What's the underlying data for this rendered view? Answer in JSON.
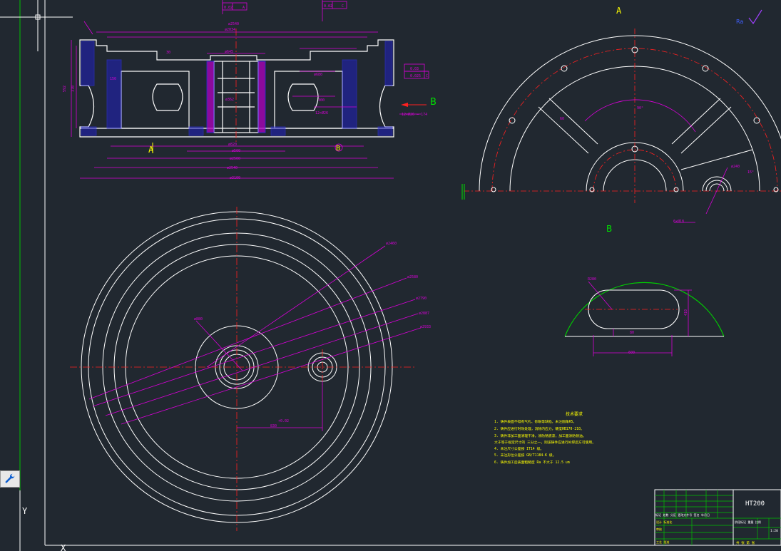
{
  "view_labels": {
    "section_a_marker": "A",
    "section_b_marker": "B",
    "view_a_title": "A",
    "view_b_title": "B",
    "bottom_b_marker": "B"
  },
  "tolerance_frames": {
    "top_left": [
      "0.02",
      "A"
    ],
    "top_right": [
      "0.02",
      "C"
    ],
    "right_1": [
      "0.03"
    ],
    "right_2": [
      "0.025",
      "C"
    ]
  },
  "section_dims": {
    "d_top": "ø2540",
    "d_mid": "ø2034",
    "d_hub": "ø645",
    "d_hub2": "ø680",
    "d_bore": "ø362",
    "d_b1": "ø820",
    "d_b2": "ø500",
    "d_b3": "ø2500",
    "d_b4": "ø2540",
    "d_bottom": "ø3100",
    "holes_left": "12×Ø26",
    "holes_right": "12×Ø26 — 174",
    "h_total": "592",
    "h_mid": "370",
    "w_30": "30",
    "d_300": "300",
    "r_150": "150"
  },
  "plan_dims": {
    "d1": "ø2460",
    "d2": "ø2580",
    "d3": "ø2790",
    "d4": "ø2887",
    "d5": "ø2933",
    "d_hub": "ø880",
    "offset": "830",
    "offset_tol": "+0.02"
  },
  "view_a_dims": {
    "angle": "90°",
    "d1": "ø240",
    "rib": "60",
    "ang2": "15°",
    "hole": "6×Ø18"
  },
  "view_b_dims": {
    "r": "R280",
    "w": "600",
    "h": "410",
    "gap": "80"
  },
  "tech_requirements": {
    "title": "技术要求",
    "items": [
      "1. 铸件表面不得有气孔、砂眼等缺陷，未注圆角R5。",
      "2. 铸件应进行时效处理，消除内应力，硬度HB170-210。",
      "3. 铸件非加工面清理干净，涂防锈底漆，加工面涂防锈油。",
      "大于等于规定尺寸的 三分之一，则该铸件应进行补焊后方可使用。",
      "4. 未注尺寸公差按 IT14 级。",
      "5. 未注形位公差按 GB/T1184-K 级。",
      "6. 铸件加工后表面粗糙度 Ra 不大于 12.5 um"
    ]
  },
  "title_block": {
    "material": "HT200",
    "rows": [
      "标记 处数 分区 更改文件号 签名 年月日",
      "设计  标准化",
      "审核",
      "工艺  批准"
    ],
    "right": [
      "阶段标记 重量 比例",
      "1:20",
      "共 张 第 张"
    ]
  },
  "ucs": {
    "y_label": "Y",
    "x_label": "X"
  },
  "colors": {
    "background": "#212830",
    "geometry": "#ffffff",
    "dimension": "#d800d8",
    "centerline": "#ff2020",
    "label": "#ffff00",
    "view_b_arc": "#00d000"
  }
}
